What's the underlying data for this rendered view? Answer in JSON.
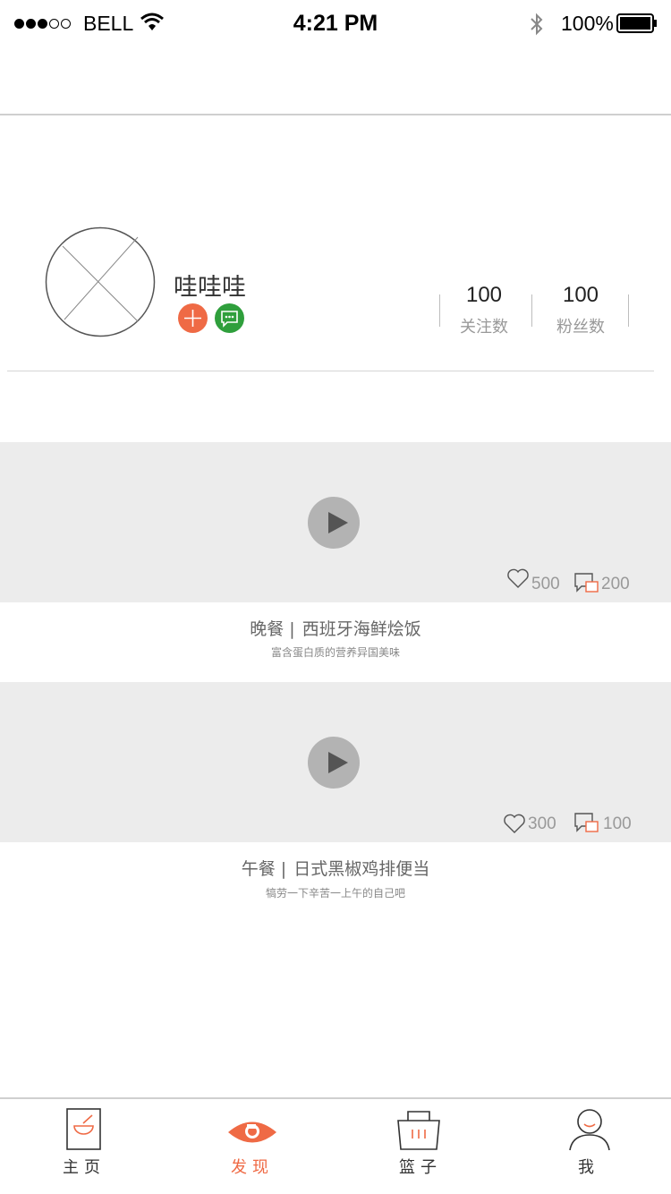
{
  "status_bar": {
    "carrier": "BELL",
    "time": "4:21 PM",
    "battery": "100%"
  },
  "profile": {
    "username": "哇哇哇",
    "following_count": "100",
    "following_label": "关注数",
    "followers_count": "100",
    "followers_label": "粉丝数"
  },
  "posts": [
    {
      "meal": "晚餐",
      "separator": "|",
      "dish": "西班牙海鲜烩饭",
      "subtitle": "富含蛋白质的营养异国美味",
      "likes": "500",
      "comments": "200"
    },
    {
      "meal": "午餐",
      "separator": "|",
      "dish": "日式黑椒鸡排便当",
      "subtitle": "犒劳一下辛苦一上午的自己吧",
      "likes": "300",
      "comments": "100"
    }
  ],
  "tabs": [
    {
      "label": "主页",
      "icon": "bowl-icon",
      "active": false
    },
    {
      "label": "发现",
      "icon": "eye-icon",
      "active": true
    },
    {
      "label": "篮子",
      "icon": "basket-icon",
      "active": false
    },
    {
      "label": "我",
      "icon": "person-icon",
      "active": false
    }
  ],
  "colors": {
    "accent": "#ef6a45",
    "message_green": "#2f9f3c",
    "video_bg": "#ececec"
  }
}
